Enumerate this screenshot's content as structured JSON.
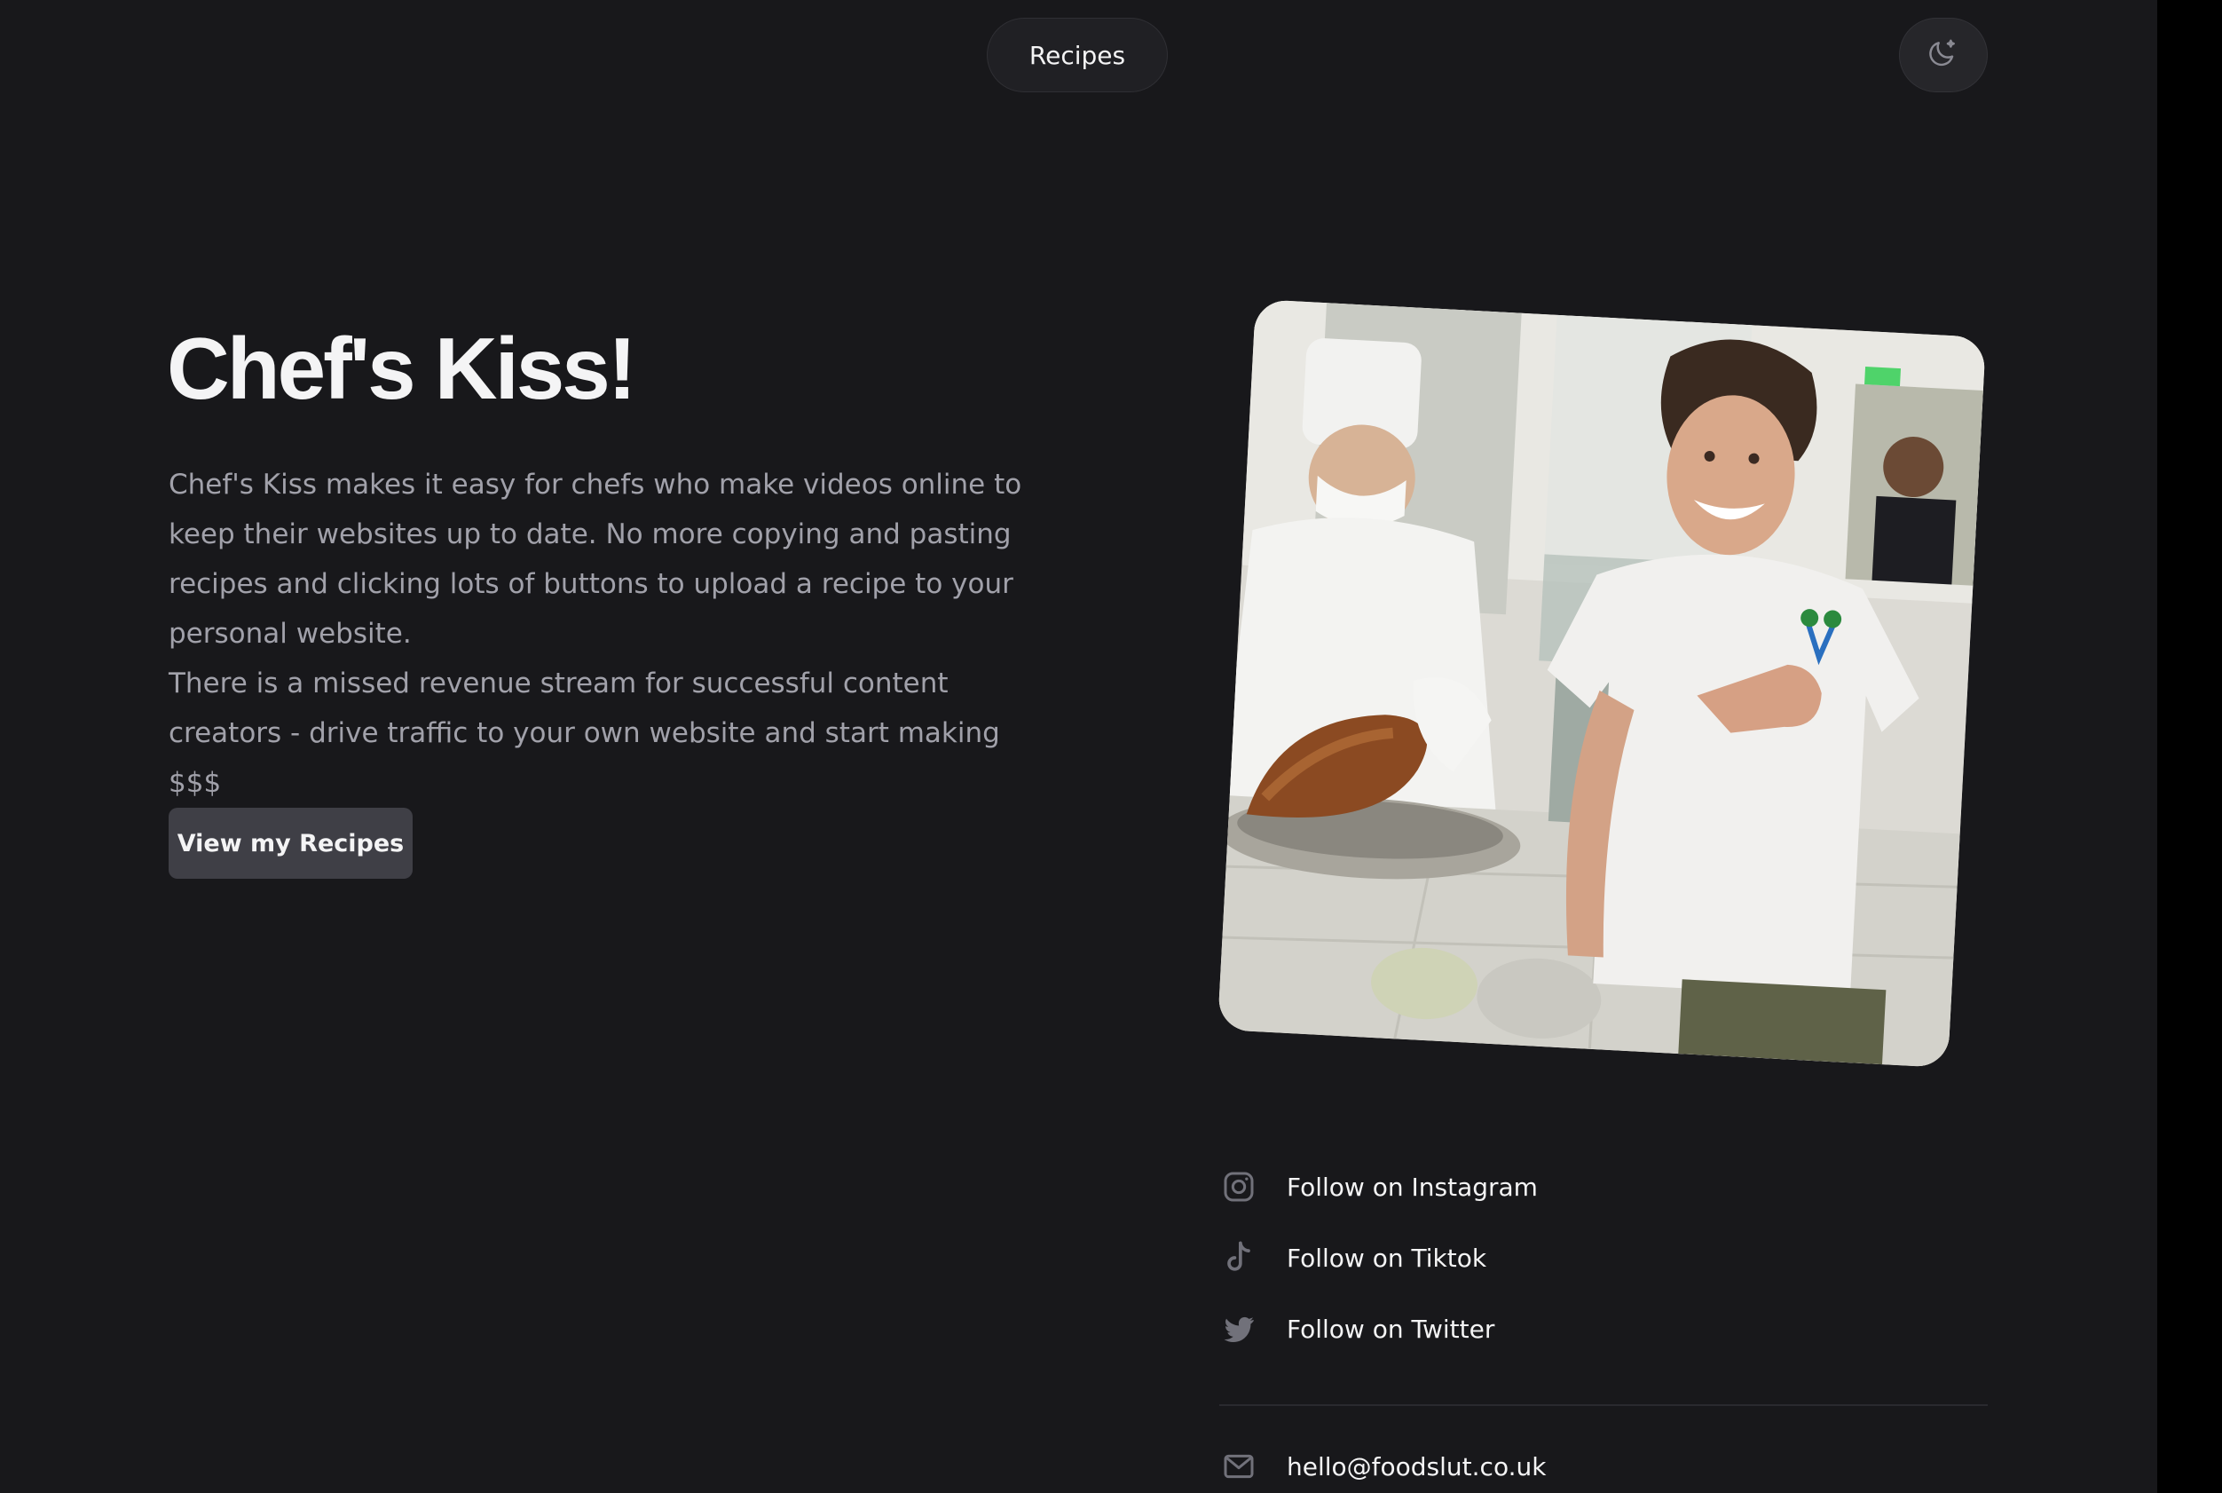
{
  "header": {
    "nav_label": "Recipes",
    "theme_toggle_icon": "moon-sparkle-icon"
  },
  "hero": {
    "title": "Chef's Kiss!",
    "paragraphs": [
      "Chef's Kiss makes it easy for chefs who make videos online to keep their websites up to date. No more copying and pasting recipes and clicking lots of buttons to upload a recipe to your personal website.",
      "There is a missed revenue stream for successful content creators - drive traffic to your own website and start making $$$"
    ],
    "cta_label": "View my Recipes"
  },
  "social": [
    {
      "label": "Follow on Instagram",
      "icon": "instagram-icon"
    },
    {
      "label": "Follow on Tiktok",
      "icon": "tiktok-icon"
    },
    {
      "label": "Follow on Twitter",
      "icon": "twitter-icon"
    }
  ],
  "contact": {
    "email": "hello@foodslut.co.uk",
    "icon": "mail-icon"
  },
  "colors": {
    "background": "#18181b",
    "text_primary": "#f4f4f5",
    "text_muted": "#a1a1aa",
    "button": "#3f3f46",
    "icon": "#71717a"
  }
}
